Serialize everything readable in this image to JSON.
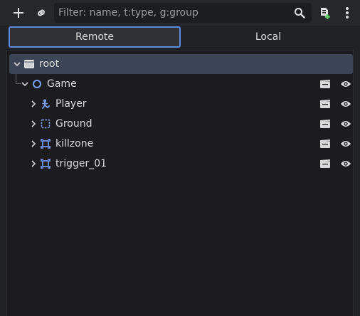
{
  "toolbar": {
    "add_icon": "plus-icon",
    "link_icon": "chain-link-icon",
    "search_icon": "magnifier-icon",
    "add_script_icon": "add-script-icon",
    "menu_icon": "vertical-dots-icon"
  },
  "filter": {
    "placeholder": "Filter: name, t:type, g:group",
    "value": ""
  },
  "tabs": [
    {
      "label": "Remote",
      "active": true
    },
    {
      "label": "Local",
      "active": false
    }
  ],
  "tree": {
    "root": {
      "label": "root",
      "icon": "window-icon",
      "selected": true,
      "expanded": true
    },
    "game": {
      "label": "Game",
      "icon": "node2d-circle-icon",
      "expanded": true
    },
    "children": [
      {
        "label": "Player",
        "icon": "character-body-icon"
      },
      {
        "label": "Ground",
        "icon": "tilemap-dashed-rect-icon"
      },
      {
        "label": "killzone",
        "icon": "area2d-icon"
      },
      {
        "label": "trigger_01",
        "icon": "area2d-icon"
      }
    ]
  },
  "colors": {
    "accent": "#5d8cdf",
    "selection": "#3b4556",
    "node_icon_blue": "#7aa2f7",
    "text": "#dcdcdc"
  }
}
